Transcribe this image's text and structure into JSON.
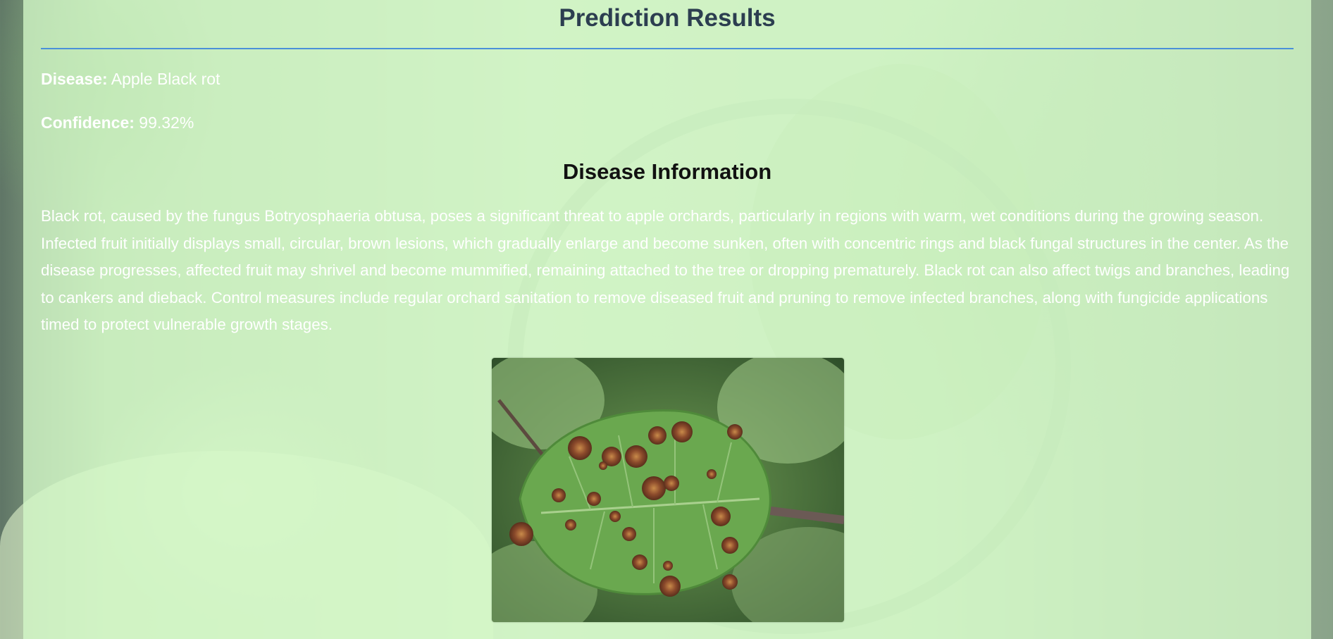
{
  "results": {
    "title": "Prediction Results",
    "disease_label": "Disease:",
    "disease_value": "Apple Black rot",
    "confidence_label": "Confidence:",
    "confidence_value": "99.32%"
  },
  "info": {
    "title": "Disease Information",
    "description": "Black rot, caused by the fungus Botryosphaeria obtusa, poses a significant threat to apple orchards, particularly in regions with warm, wet conditions during the growing season. Infected fruit initially displays small, circular, brown lesions, which gradually enlarge and become sunken, often with concentric rings and black fungal structures in the center. As the disease progresses, affected fruit may shrivel and become mummified, remaining attached to the tree or dropping prematurely. Black rot can also affect twigs and branches, leading to cankers and dieback. Control measures include regular orchard sanitation to remove diseased fruit and pruning to remove infected branches, along with fungicide applications timed to protect vulnerable growth stages."
  },
  "colors": {
    "title_color": "#2c3e50",
    "divider_color": "#4a90d9",
    "panel_tint": "#d4f8c8",
    "lesion_brown": "#8b4a2b"
  }
}
